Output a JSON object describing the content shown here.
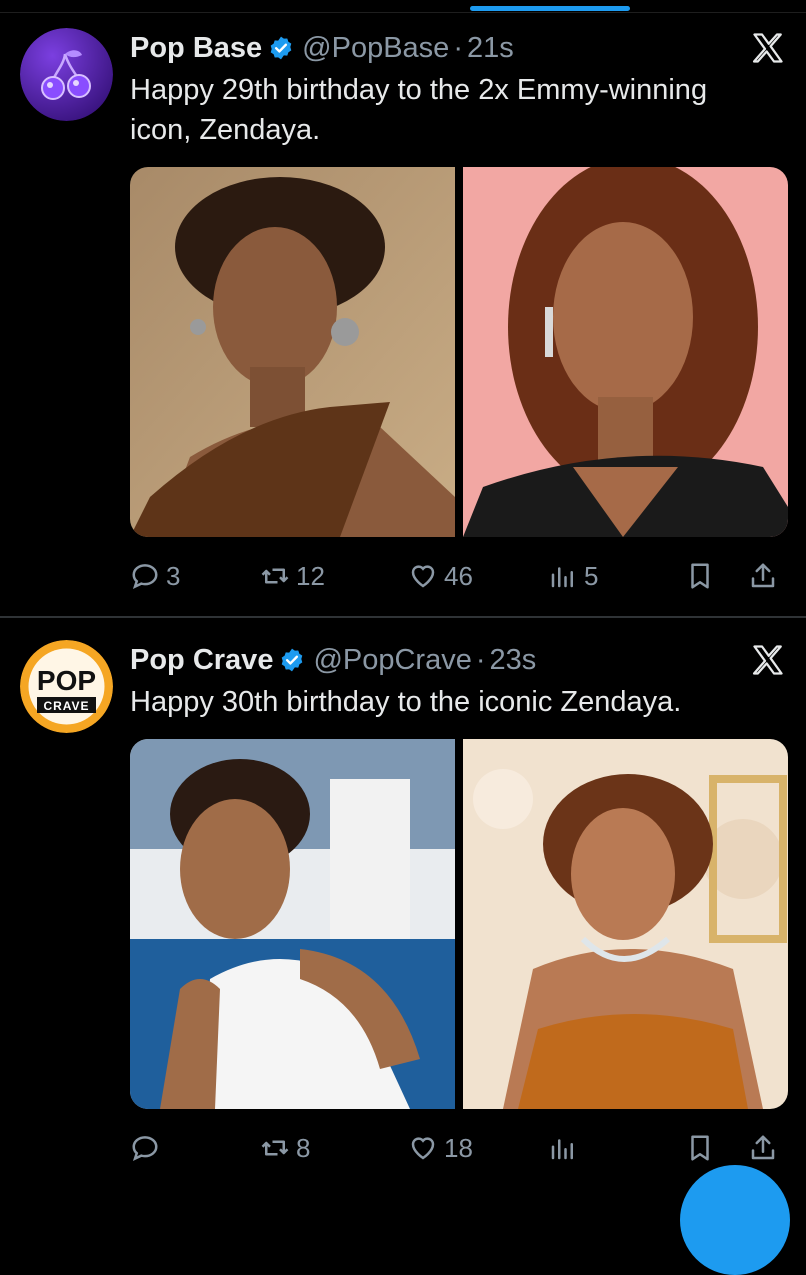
{
  "colors": {
    "background": "#000000",
    "text": "#e7e9ea",
    "secondary_text": "#8b98a5",
    "verified_blue": "#1d9bf0",
    "divider": "#2f3336",
    "popbase_avatar": "#5b2db3",
    "popcrave_avatar": "#f5a623"
  },
  "tweets": [
    {
      "name": "Pop Base",
      "handle": "@PopBase",
      "separator": "·",
      "time": "21s",
      "text": "Happy 29th birthday to the 2x Emmy-winning icon, Zendaya.",
      "avatar_icon": "cherry-icon",
      "photos": [
        "photo-zendaya-brown-dress",
        "photo-zendaya-pink-backdrop"
      ],
      "replies": "3",
      "reposts": "12",
      "likes": "46",
      "views": "5"
    },
    {
      "name": "Pop Crave",
      "handle": "@PopCrave",
      "separator": "·",
      "time": "23s",
      "text": "Happy 30th birthday to the iconic Zendaya.",
      "avatar_text_top": "POP",
      "avatar_text_bottom": "CRAVE",
      "photos": [
        "photo-zendaya-tennis-court",
        "photo-zendaya-orange-gown"
      ],
      "replies": "",
      "reposts": "8",
      "likes": "18",
      "views": ""
    }
  ]
}
